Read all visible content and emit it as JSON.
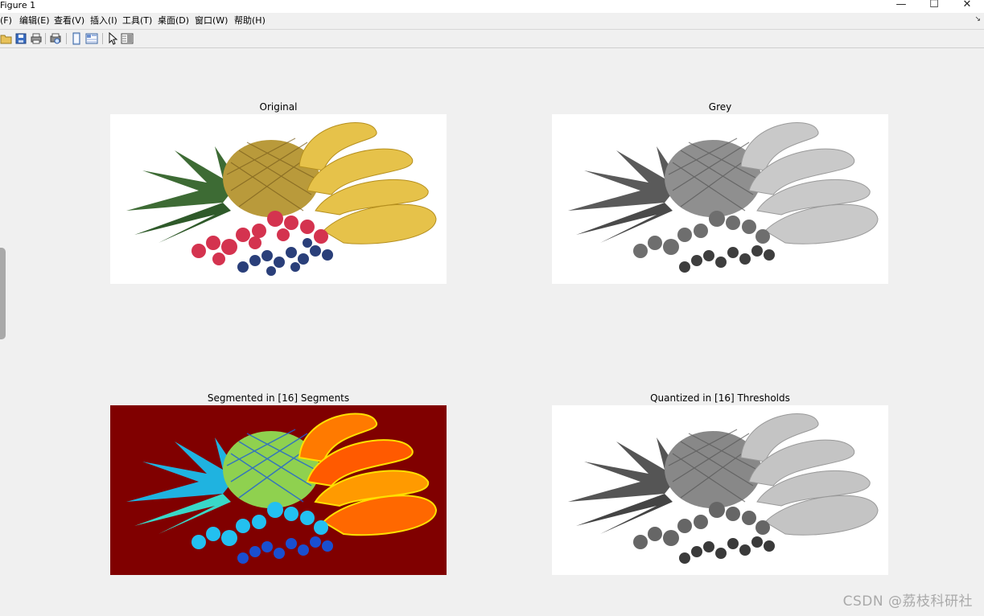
{
  "window": {
    "title": "Figure 1",
    "controls": {
      "minimize": "—",
      "maximize": "☐",
      "close": "✕"
    }
  },
  "menubar": {
    "items": [
      "(F)",
      "编辑(E)",
      "查看(V)",
      "插入(I)",
      "工具(T)",
      "桌面(D)",
      "窗口(W)",
      "帮助(H)"
    ],
    "overflow_arrow": "↘"
  },
  "toolbar": {
    "buttons": [
      "open-folder-icon",
      "save-icon",
      "print-icon",
      "print-preview-icon",
      "link-plot-icon",
      "property-editor-icon",
      "pointer-icon",
      "dock-panel-icon"
    ]
  },
  "panels": {
    "original": {
      "title": "Original"
    },
    "grey": {
      "title": "Grey"
    },
    "segmented": {
      "title": "Segmented in [16] Segments"
    },
    "quantized": {
      "title": "Quantized in [16] Thresholds"
    }
  },
  "watermark": "CSDN @荔枝科研社",
  "colors": {
    "segment_background": "#800000",
    "figure_background": "#f0f0f0",
    "plot_background": "#ffffff"
  }
}
